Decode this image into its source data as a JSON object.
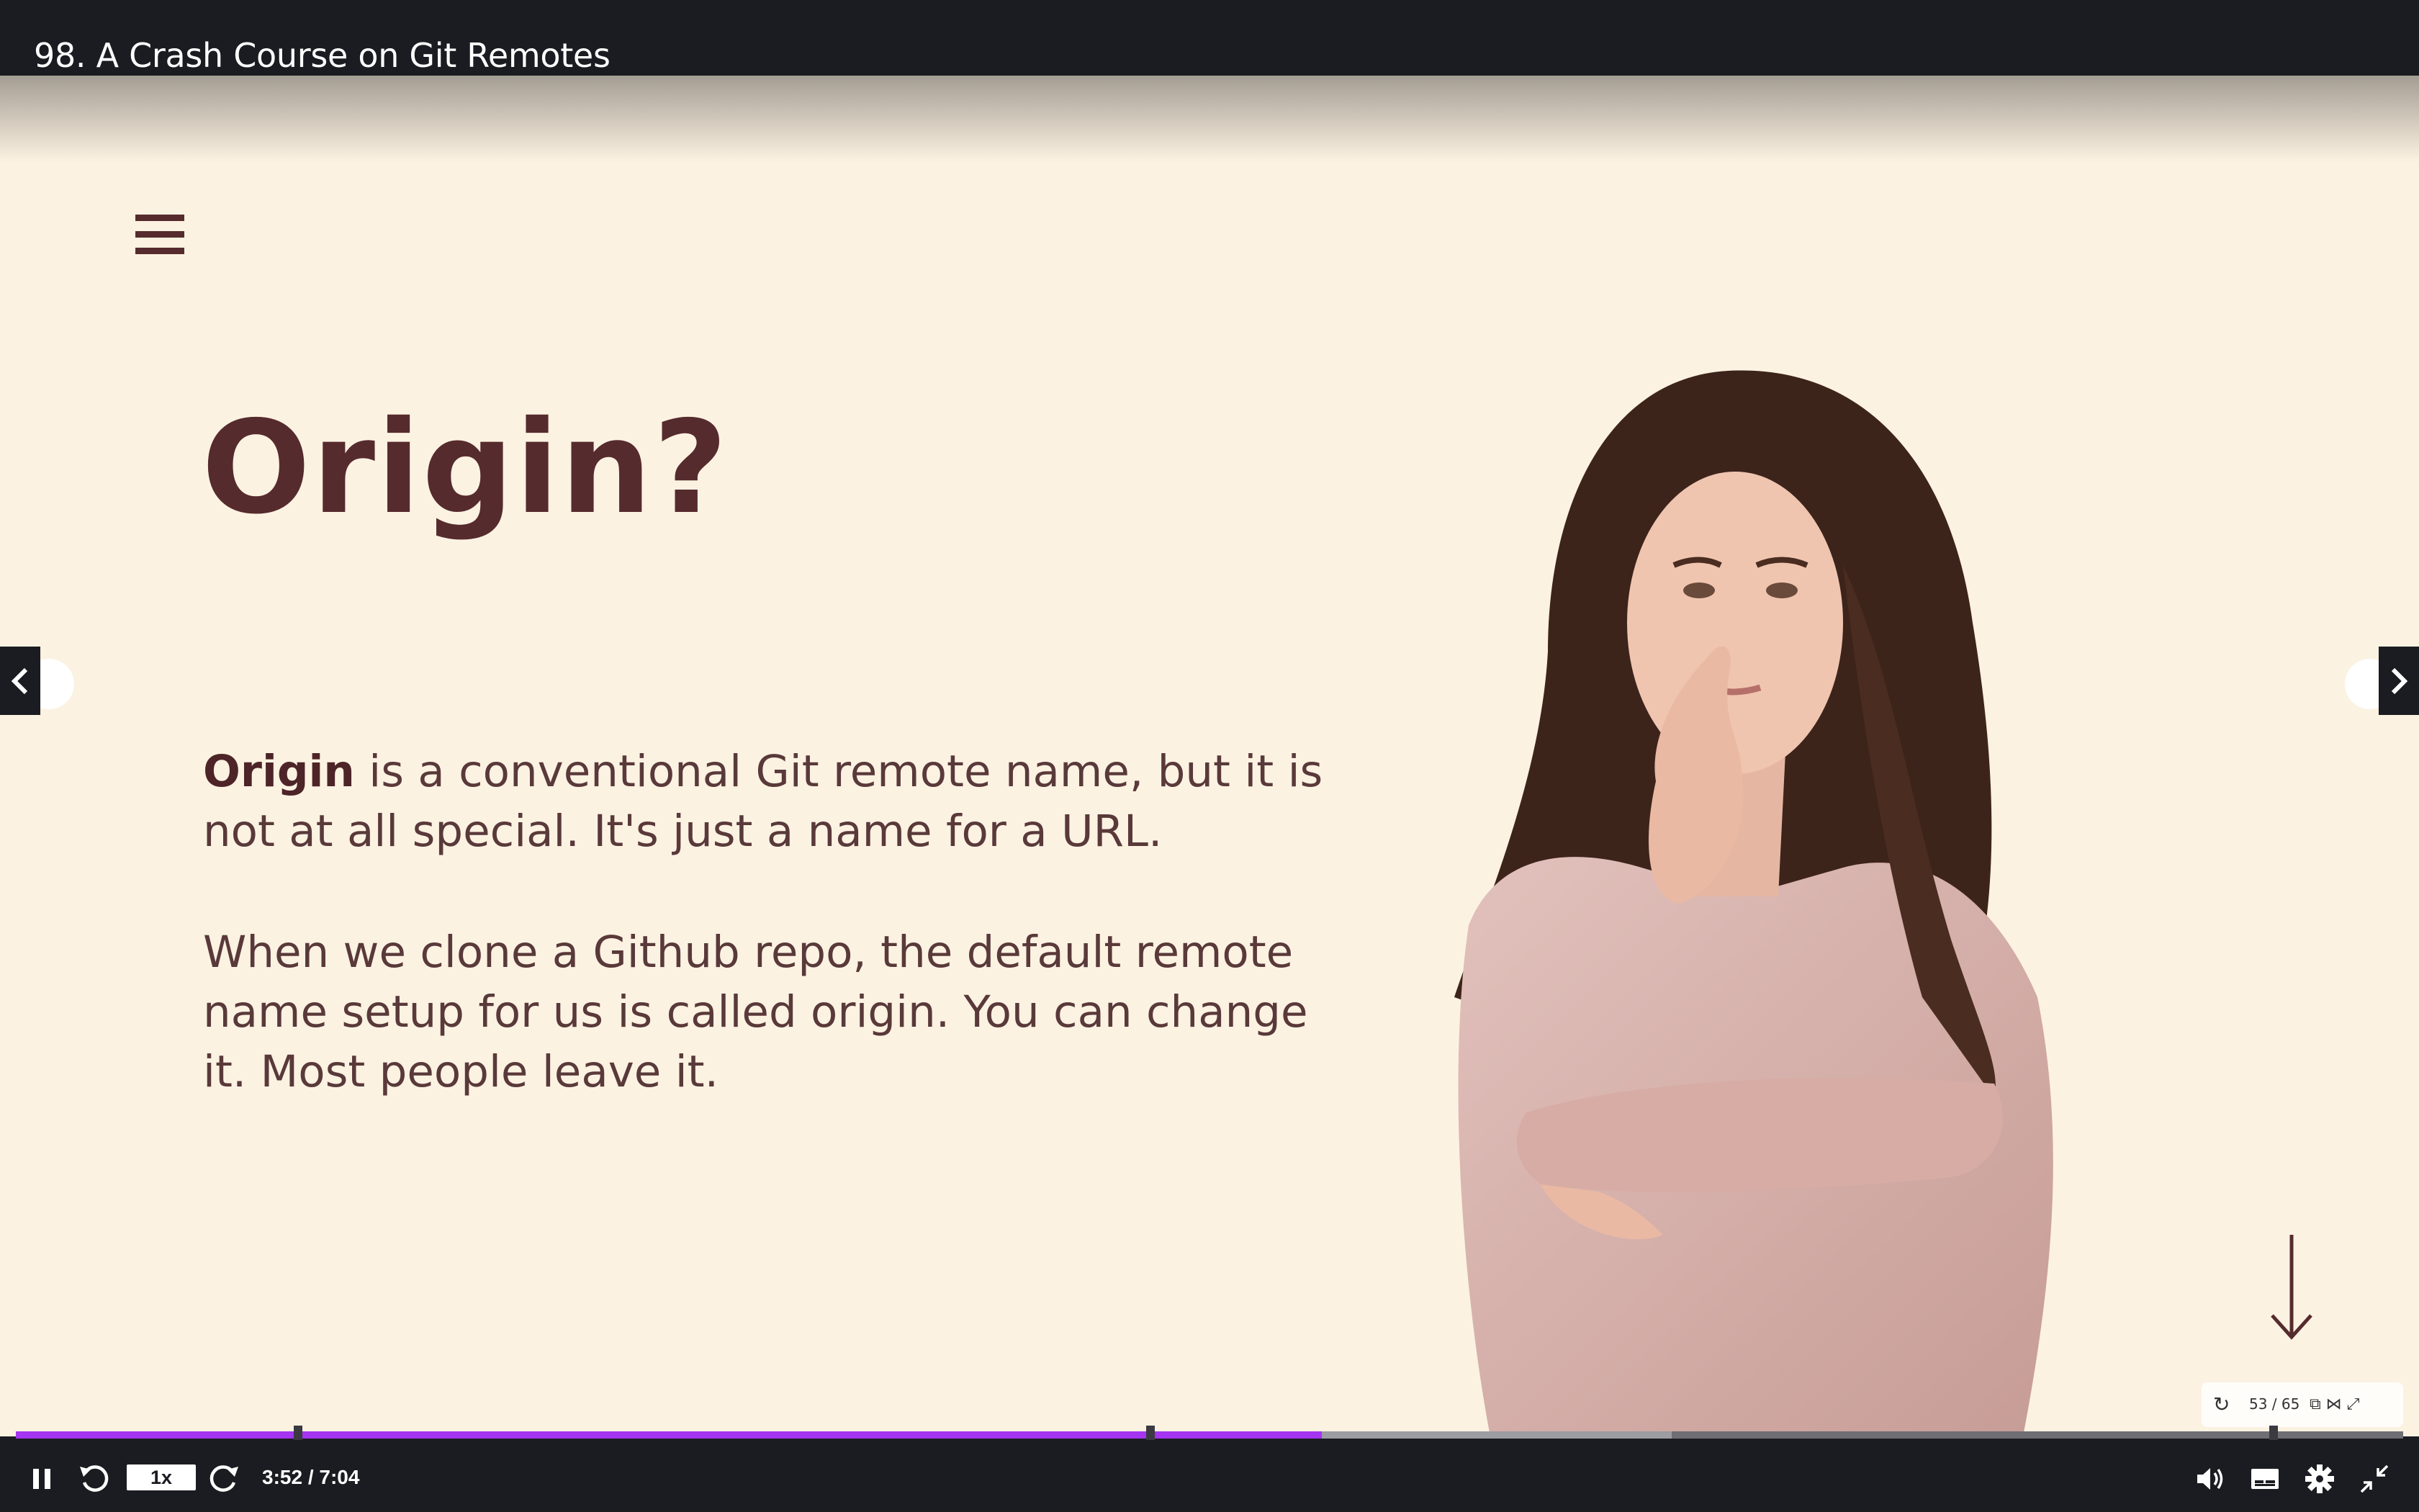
{
  "header": {
    "title": "98. A Crash Course on Git Remotes"
  },
  "slide": {
    "title": "Origin?",
    "para1_bold": "Origin",
    "para1_rest": " is a conventional Git remote name, but it is not at all special.  It's just a name for a URL.",
    "para2": "When we clone a Github repo, the default remote name setup for us is called origin.  You can change it.  Most people leave it.",
    "slide_counter": "53 / 65"
  },
  "player": {
    "speed_label": "1x",
    "time_display": "3:52 / 7:04",
    "current_time": "3:52",
    "duration": "7:04",
    "progress": 0.547
  },
  "colors": {
    "accent": "#a435f0",
    "slide_background": "#fcf2e2",
    "slide_text": "#562b2d",
    "chrome": "#1b1c21"
  },
  "icons": {
    "menu": "hamburger-icon",
    "prev": "chevron-left-icon",
    "next": "chevron-right-icon",
    "scroll": "arrow-down-icon",
    "pause": "pause-icon",
    "rewind": "rewind-5-icon",
    "forward": "forward-5-icon",
    "volume": "volume-icon",
    "captions": "captions-icon",
    "settings": "gear-icon",
    "fullscreen": "exit-fullscreen-icon"
  }
}
